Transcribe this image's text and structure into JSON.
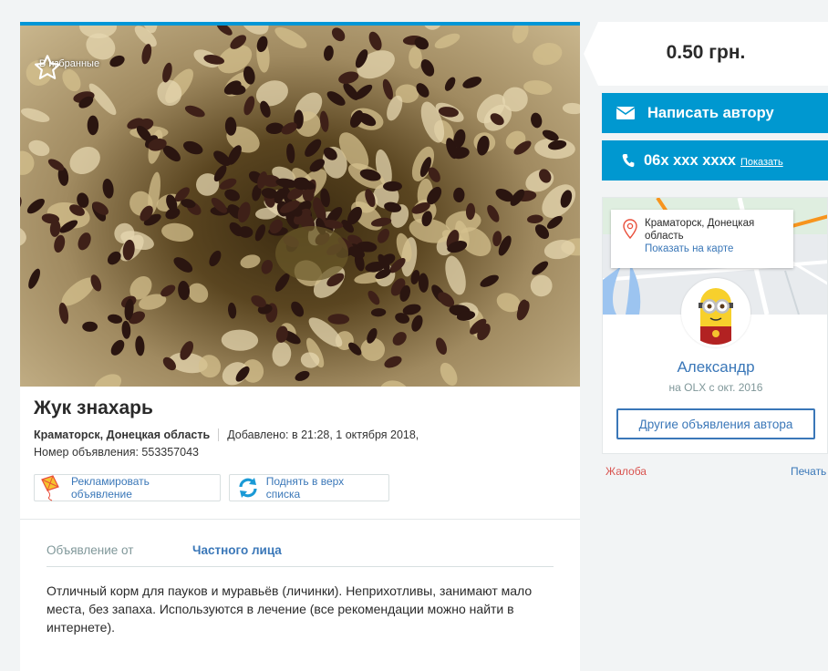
{
  "ad": {
    "favorite_label": "В избранные",
    "title": "Жук знахарь",
    "location": "Краматорск, Донецкая область",
    "added": "Добавлено: в 21:28, 1 октября 2018,",
    "ad_number": "Номер объявления: 553357043",
    "promote_label": "Рекламировать объявление",
    "raise_label": "Поднять в верх списка",
    "details": {
      "key": "Объявление от",
      "value": "Частного лица"
    },
    "description": "Отличный корм для пауков и муравьёв (личинки). Неприхотливы, занимают мало места, без запаха. Используются в лечение (все рекомендации можно найти в интернете)."
  },
  "sidebar": {
    "price": "0.50 грн.",
    "message_label": "Написать автору",
    "phone_masked": "06х ххх хххх",
    "phone_show": "Показать",
    "map": {
      "city": "Краматорск, Донецкая область",
      "show_on_map": "Показать на карте"
    },
    "user_name": "Александр",
    "user_since": "на OLX с окт. 2016",
    "other_ads_label": "Другие объявления автора",
    "complaint_label": "Жалоба",
    "print_label": "Печать"
  },
  "icons": {
    "favorite": "star-icon",
    "promote": "kite-icon",
    "raise": "refresh-icon",
    "message": "envelope-icon",
    "phone": "phone-icon",
    "location": "map-pin-icon"
  },
  "colors": {
    "accent_blue": "#0098d0",
    "link_blue": "#3a77b8",
    "complaint_red": "#d9534f",
    "map_orange": "#f7941d"
  }
}
